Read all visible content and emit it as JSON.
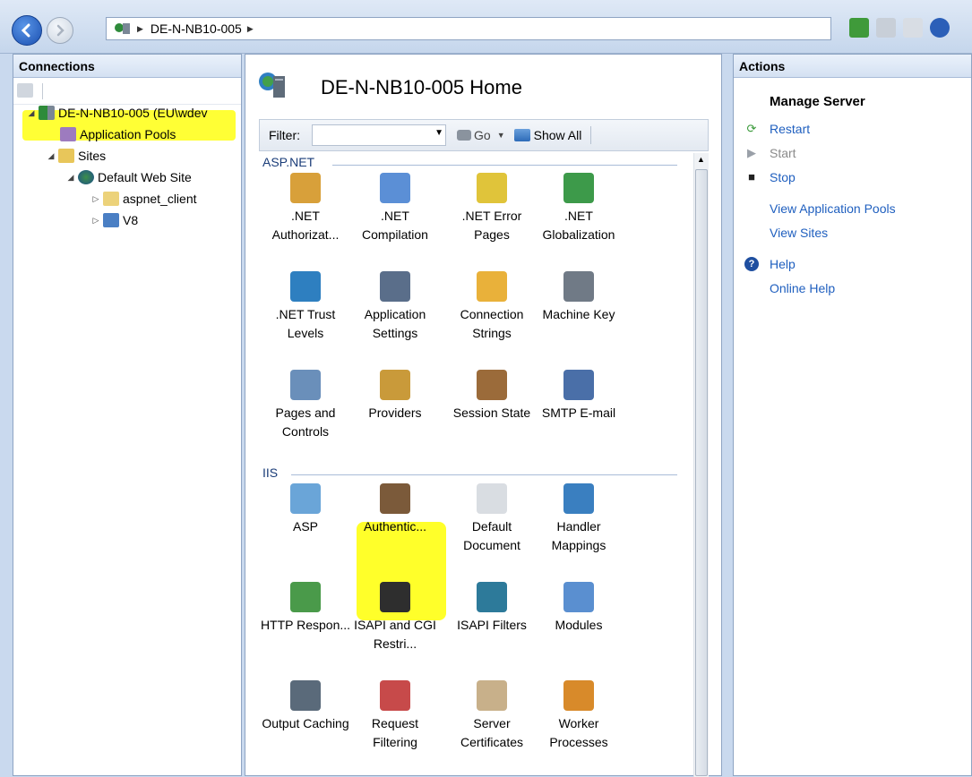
{
  "address_bar": {
    "crumbs": [
      "DE-N-NB10-005"
    ]
  },
  "connections": {
    "header": "Connections",
    "tree": [
      {
        "label": "DE-N-NB10-005 (EU\\wdev",
        "icon": "server-icon",
        "level": 0
      },
      {
        "label": "Application Pools",
        "icon": "app-pools-icon",
        "level": 1
      },
      {
        "label": "Sites",
        "icon": "sites-folder-icon",
        "level": 1
      },
      {
        "label": "Default Web Site",
        "icon": "website-icon",
        "level": 2
      },
      {
        "label": "aspnet_client",
        "icon": "folder-icon",
        "level": 3
      },
      {
        "label": "V8",
        "icon": "application-icon",
        "level": 3
      }
    ]
  },
  "home": {
    "title": "DE-N-NB10-005 Home",
    "filter_label": "Filter:",
    "go_label": "Go",
    "show_all_label": "Show All"
  },
  "groups": [
    {
      "name": "ASP.NET",
      "features": [
        ".NET Authorizat...",
        ".NET Compilation",
        ".NET Error Pages",
        ".NET Globalization",
        ".NET Trust Levels",
        "Application Settings",
        "Connection Strings",
        "Machine Key",
        "Pages and Controls",
        "Providers",
        "Session State",
        "SMTP E-mail"
      ]
    },
    {
      "name": "IIS",
      "features": [
        "ASP",
        "Authentic...",
        "Default Document",
        "Handler Mappings",
        "HTTP Respon...",
        "ISAPI and CGI Restri...",
        "ISAPI Filters",
        "Modules",
        "Output Caching",
        "Request Filtering",
        "Server Certificates",
        "Worker Processes"
      ]
    }
  ],
  "feature_icons": [
    "lock-icon",
    "compile-icon",
    "error-404-icon",
    "globe-icon",
    "trust-globe-icon",
    "settings-list-icon",
    "database-icon",
    "key-icon",
    "page-controls-icon",
    "providers-icon",
    "session-icon",
    "mail-icon",
    "asp-icon",
    "authentication-icon",
    "document-icon",
    "handler-icon",
    "http-response-icon",
    "cgi-restriction-icon",
    "isapi-filter-icon",
    "modules-icon",
    "output-cache-icon",
    "request-filter-icon",
    "certificate-icon",
    "worker-process-icon"
  ],
  "actions": {
    "header": "Actions",
    "section_title": "Manage Server",
    "items": [
      {
        "label": "Restart",
        "icon": "restart-icon",
        "state": "link"
      },
      {
        "label": "Start",
        "icon": "start-icon",
        "state": "disabled"
      },
      {
        "label": "Stop",
        "icon": "stop-icon",
        "state": "link"
      },
      {
        "label": "View Application Pools",
        "icon": "",
        "state": "link"
      },
      {
        "label": "View Sites",
        "icon": "",
        "state": "link"
      },
      {
        "label": "Help",
        "icon": "help-icon",
        "state": "link"
      },
      {
        "label": "Online Help",
        "icon": "",
        "state": "link"
      }
    ]
  },
  "colors": {
    "highlight": "#ffff2a",
    "link": "#1f5fbf",
    "panel_border": "#8ea4c3"
  }
}
